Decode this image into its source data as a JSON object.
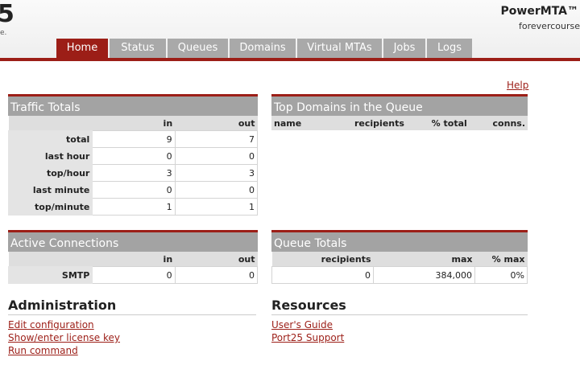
{
  "header": {
    "logo_fragment": "5",
    "logo_dot": "e.",
    "brand": "PowerMTA™",
    "hostname": "forevercourse"
  },
  "tabs": [
    {
      "label": "Home",
      "active": true
    },
    {
      "label": "Status",
      "active": false
    },
    {
      "label": "Queues",
      "active": false
    },
    {
      "label": "Domains",
      "active": false
    },
    {
      "label": "Virtual MTAs",
      "active": false
    },
    {
      "label": "Jobs",
      "active": false
    },
    {
      "label": "Logs",
      "active": false
    }
  ],
  "help": "Help",
  "traffic_totals": {
    "title": "Traffic Totals",
    "col_in": "in",
    "col_out": "out",
    "rows": [
      {
        "label": "total",
        "in": "9",
        "out": "7"
      },
      {
        "label": "last hour",
        "in": "0",
        "out": "0"
      },
      {
        "label": "top/hour",
        "in": "3",
        "out": "3"
      },
      {
        "label": "last minute",
        "in": "0",
        "out": "0"
      },
      {
        "label": "top/minute",
        "in": "1",
        "out": "1"
      }
    ]
  },
  "top_domains": {
    "title": "Top Domains in the Queue",
    "col_name": "name",
    "col_recipients": "recipients",
    "col_total": "% total",
    "col_conns": "conns."
  },
  "active_connections": {
    "title": "Active Connections",
    "col_in": "in",
    "col_out": "out",
    "rows": [
      {
        "label": "SMTP",
        "in": "0",
        "out": "0"
      }
    ]
  },
  "queue_totals": {
    "title": "Queue Totals",
    "col_recipients": "recipients",
    "col_max": "max",
    "col_pct_max": "% max",
    "recipients": "0",
    "max": "384,000",
    "pct_max": "0%"
  },
  "administration": {
    "title": "Administration",
    "links": [
      "Edit configuration",
      "Show/enter license key",
      "Run command"
    ]
  },
  "resources": {
    "title": "Resources",
    "links": [
      "User's Guide",
      "Port25 Support"
    ]
  },
  "colors": {
    "accent": "#9c1e17",
    "tab_inactive": "#a9a9a9",
    "panel_header": "#a3a3a3"
  }
}
